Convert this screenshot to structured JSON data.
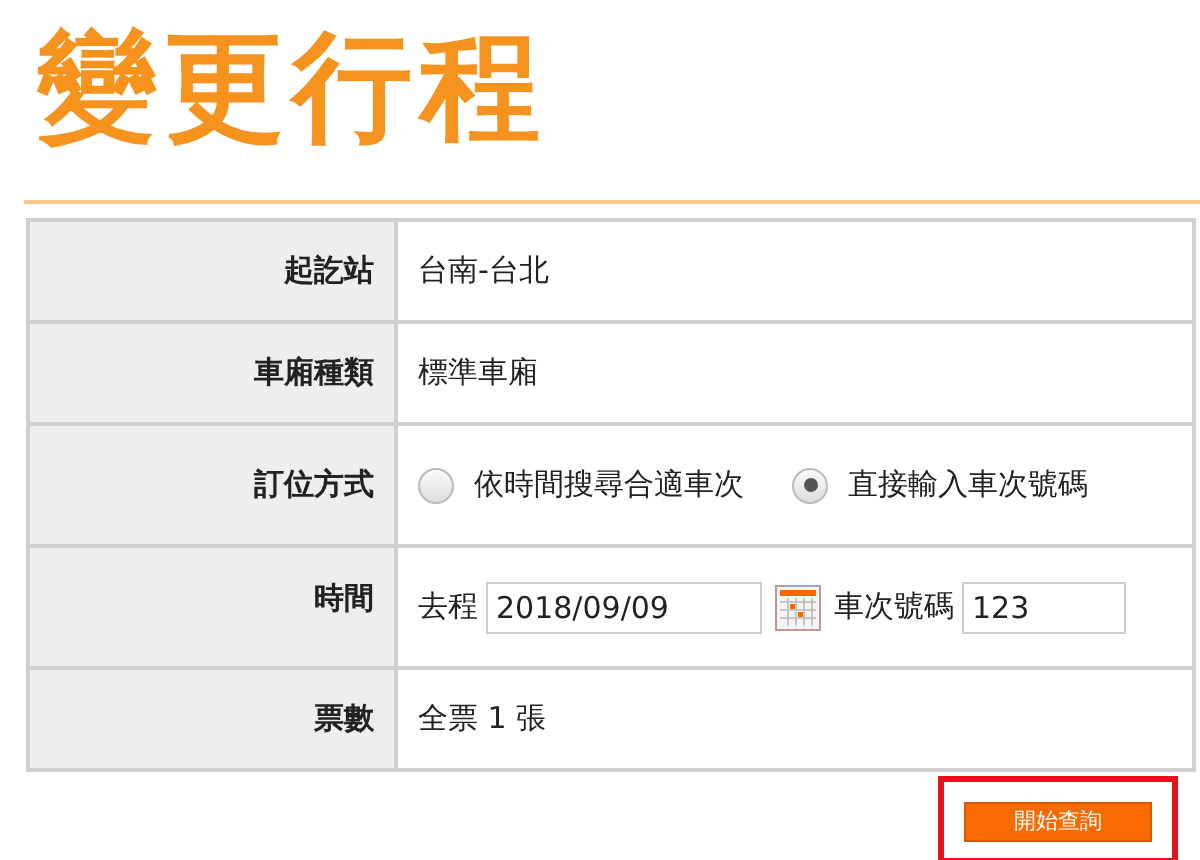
{
  "title": "變更行程",
  "rows": [
    {
      "label": "起訖站",
      "kind": "text",
      "value": "台南-台北"
    },
    {
      "label": "車廂種類",
      "kind": "text",
      "value": "標準車廂"
    },
    {
      "label": "訂位方式",
      "kind": "radio",
      "options": [
        {
          "label": "依時間搜尋合適車次",
          "selected": false
        },
        {
          "label": "直接輸入車次號碼",
          "selected": true
        }
      ]
    },
    {
      "label": "時間",
      "kind": "time",
      "direction_label": "去程",
      "date": "2018/09/09",
      "train_label": "車次號碼",
      "train": "123"
    },
    {
      "label": "票數",
      "kind": "text",
      "value": "全票 1 張"
    }
  ],
  "button": {
    "label": "開始查詢",
    "highlighted": true
  }
}
